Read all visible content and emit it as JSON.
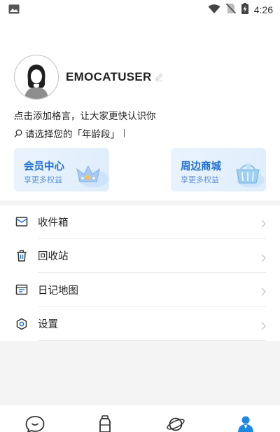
{
  "status_bar": {
    "time": "4:26",
    "icons": [
      "image-icon",
      "wifi-icon",
      "no-sim-icon",
      "battery-charging-icon"
    ]
  },
  "profile": {
    "username": "EMOCATUSER",
    "motto_prompt": "点击添加格言，让大家更快认识你",
    "age_prompt": "请选择您的「年龄段」"
  },
  "cards": [
    {
      "title": "会员中心",
      "subtitle": "享更多权益",
      "icon": "crown-icon"
    },
    {
      "title": "周边商城",
      "subtitle": "享更多权益",
      "icon": "shopping-basket-icon"
    }
  ],
  "menu": [
    {
      "label": "收件箱",
      "icon": "inbox-icon"
    },
    {
      "label": "回收站",
      "icon": "trash-icon"
    },
    {
      "label": "日记地图",
      "icon": "map-icon"
    },
    {
      "label": "设置",
      "icon": "settings-icon"
    }
  ],
  "tabbar": {
    "tabs": [
      "chat-icon",
      "bottle-icon",
      "planet-icon",
      "profile-icon"
    ],
    "active_index": 3
  },
  "colors": {
    "accent": "#1f6fd0",
    "card_bg": "#e6f1fd",
    "tab_active": "#1e88e5"
  }
}
